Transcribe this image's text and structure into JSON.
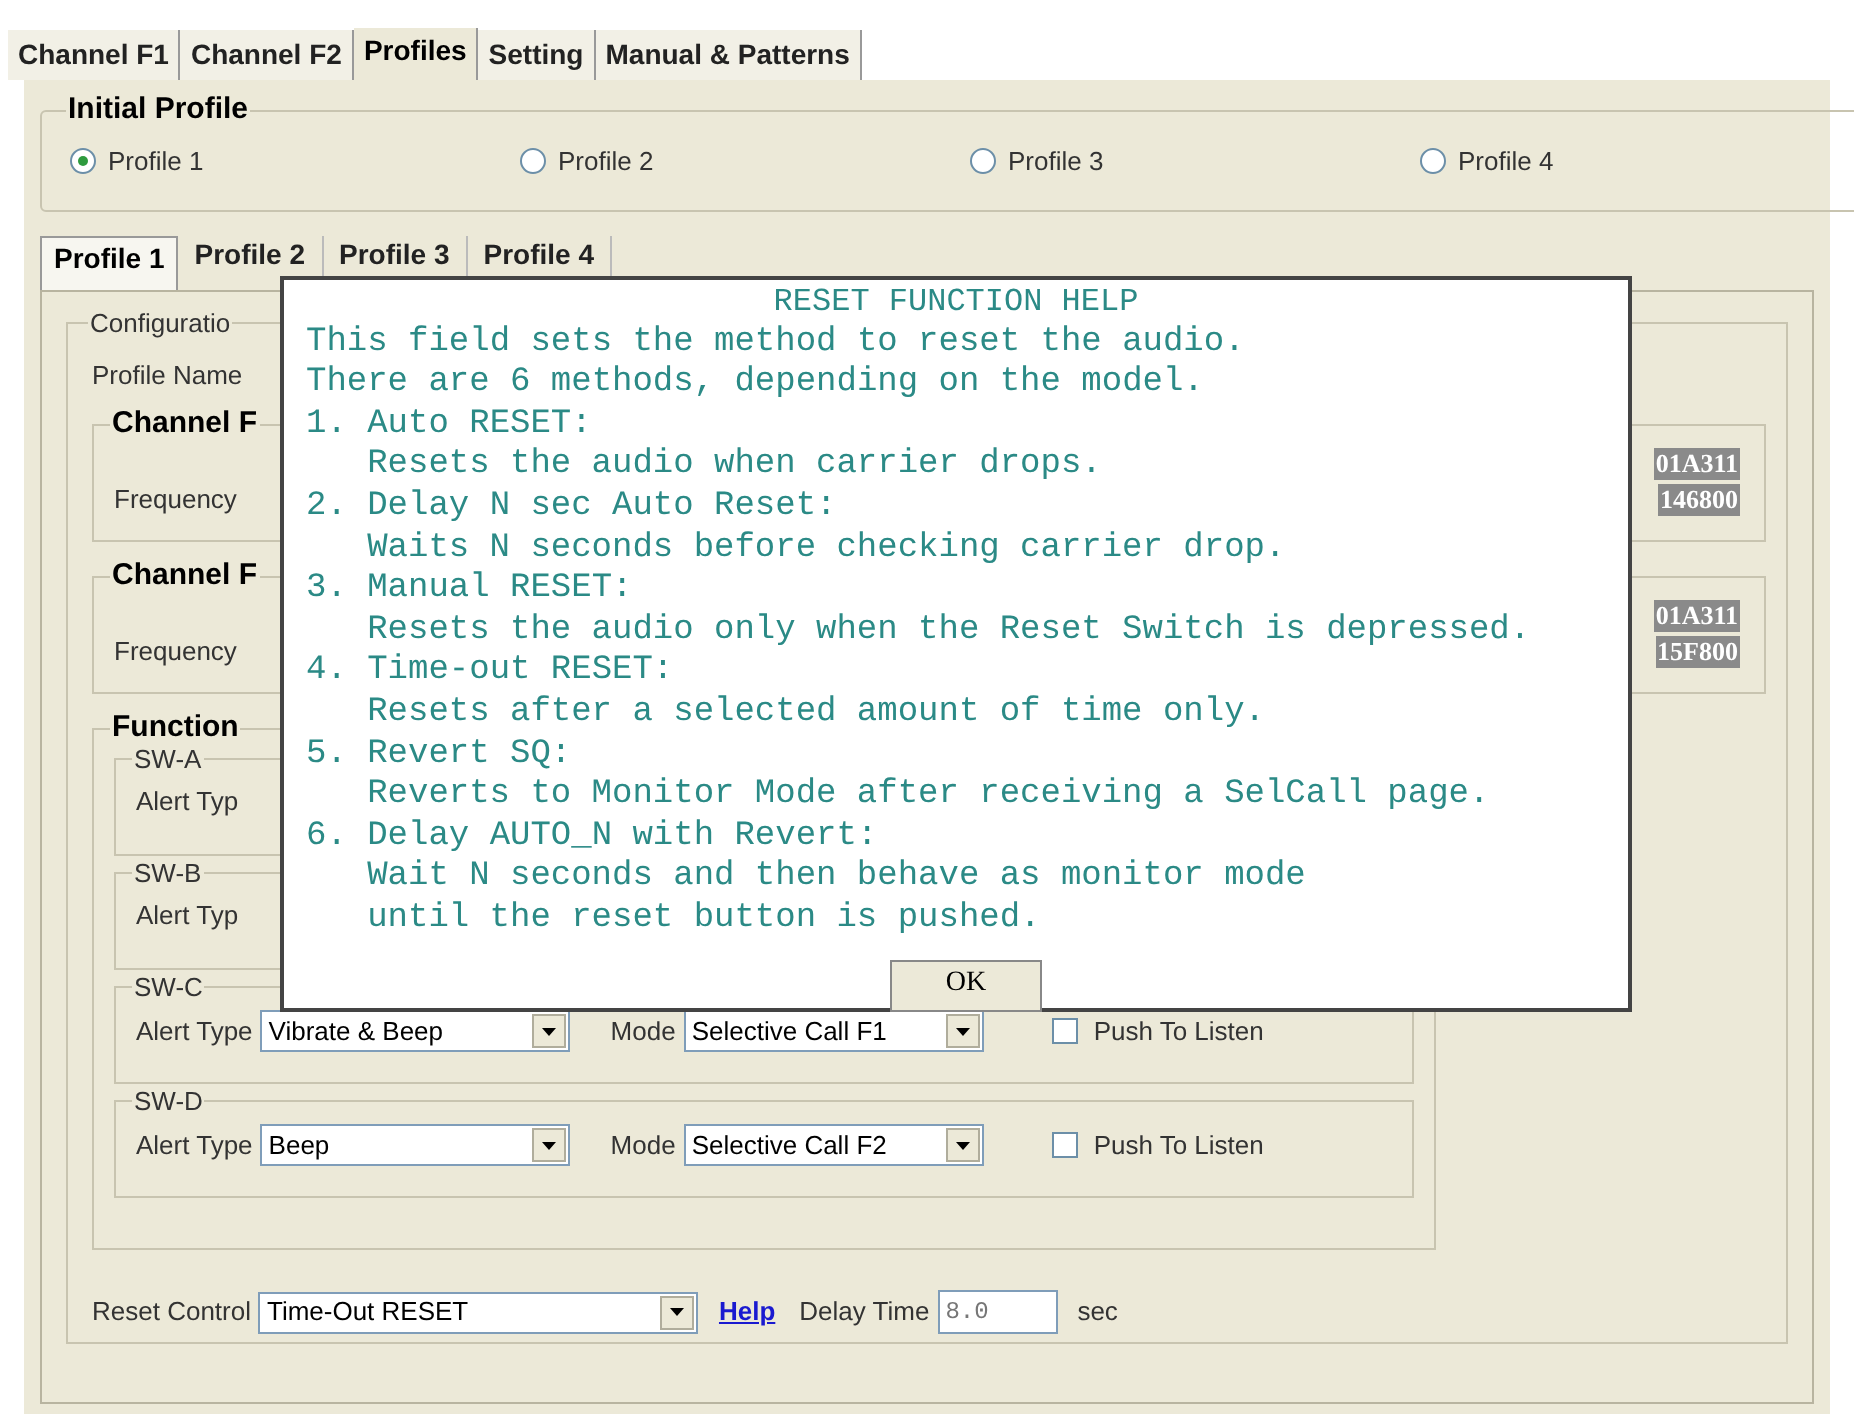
{
  "tabs": [
    {
      "label": "Channel F1",
      "selected": false
    },
    {
      "label": "Channel F2",
      "selected": false
    },
    {
      "label": "Profiles",
      "selected": true
    },
    {
      "label": "Setting",
      "selected": false
    },
    {
      "label": "Manual & Patterns",
      "selected": false
    }
  ],
  "initial_profile": {
    "title": "Initial Profile",
    "options": [
      {
        "label": "Profile 1",
        "selected": true
      },
      {
        "label": "Profile 2",
        "selected": false
      },
      {
        "label": "Profile 3",
        "selected": false
      },
      {
        "label": "Profile 4",
        "selected": false
      }
    ]
  },
  "profile_tabs": [
    {
      "label": "Profile 1",
      "selected": true
    },
    {
      "label": "Profile 2",
      "selected": false
    },
    {
      "label": "Profile 3",
      "selected": false
    },
    {
      "label": "Profile 4",
      "selected": false
    }
  ],
  "configuration": {
    "title": "Configuratio",
    "profile_name_label": "Profile Name",
    "channel_groups": [
      {
        "title": "Channel F",
        "frequency_label": "Frequency",
        "values": [
          "01A311",
          "146800"
        ]
      },
      {
        "title": "Channel F",
        "frequency_label": "Frequency",
        "values": [
          "01A311",
          "15F800"
        ]
      }
    ]
  },
  "function": {
    "title": "Function",
    "switches": [
      {
        "title": "SW-A",
        "alert_type_label": "Alert Typ"
      },
      {
        "title": "SW-B",
        "alert_type_label": "Alert Typ"
      },
      {
        "title": "SW-C",
        "alert_type_label": "Alert Type",
        "alert_type": "Vibrate & Beep",
        "mode_label": "Mode",
        "mode": "Selective Call F1",
        "push_to_listen": {
          "label": "Push To Listen",
          "checked": false
        }
      },
      {
        "title": "SW-D",
        "alert_type_label": "Alert Type",
        "alert_type": "Beep",
        "mode_label": "Mode",
        "mode": "Selective Call F2",
        "push_to_listen": {
          "label": "Push To Listen",
          "checked": false
        }
      }
    ]
  },
  "reset_control": {
    "label": "Reset Control",
    "value": "Time-Out RESET",
    "help": "Help",
    "delay_label": "Delay Time",
    "delay_value": "8.0",
    "unit": "sec"
  },
  "dialog": {
    "title": "RESET FUNCTION HELP",
    "lines": [
      {
        "kind": "text",
        "text": "This field sets the method to reset the audio."
      },
      {
        "kind": "text",
        "text": "There are 6 methods, depending on the model."
      },
      {
        "kind": "text",
        "text": "1. Auto RESET:"
      },
      {
        "kind": "detail",
        "text": "Resets the audio when carrier drops."
      },
      {
        "kind": "text",
        "text": "2. Delay N sec Auto Reset:"
      },
      {
        "kind": "detail",
        "text": "Waits N seconds before checking carrier drop."
      },
      {
        "kind": "text",
        "text": "3. Manual RESET:"
      },
      {
        "kind": "detail",
        "text": "Resets the audio only when the Reset Switch is depressed."
      },
      {
        "kind": "text",
        "text": "4. Time-out RESET:"
      },
      {
        "kind": "detail",
        "text": "Resets after a selected amount of time only."
      },
      {
        "kind": "text",
        "text": "5. Revert SQ:"
      },
      {
        "kind": "detail",
        "text": "Reverts to Monitor Mode after receiving a SelCall page."
      },
      {
        "kind": "text",
        "text": "6. Delay AUTO_N with Revert:"
      },
      {
        "kind": "detail",
        "text": "Wait N seconds and then behave as monitor mode"
      },
      {
        "kind": "detail",
        "text": "until the reset button is pushed."
      }
    ],
    "ok": "OK"
  }
}
